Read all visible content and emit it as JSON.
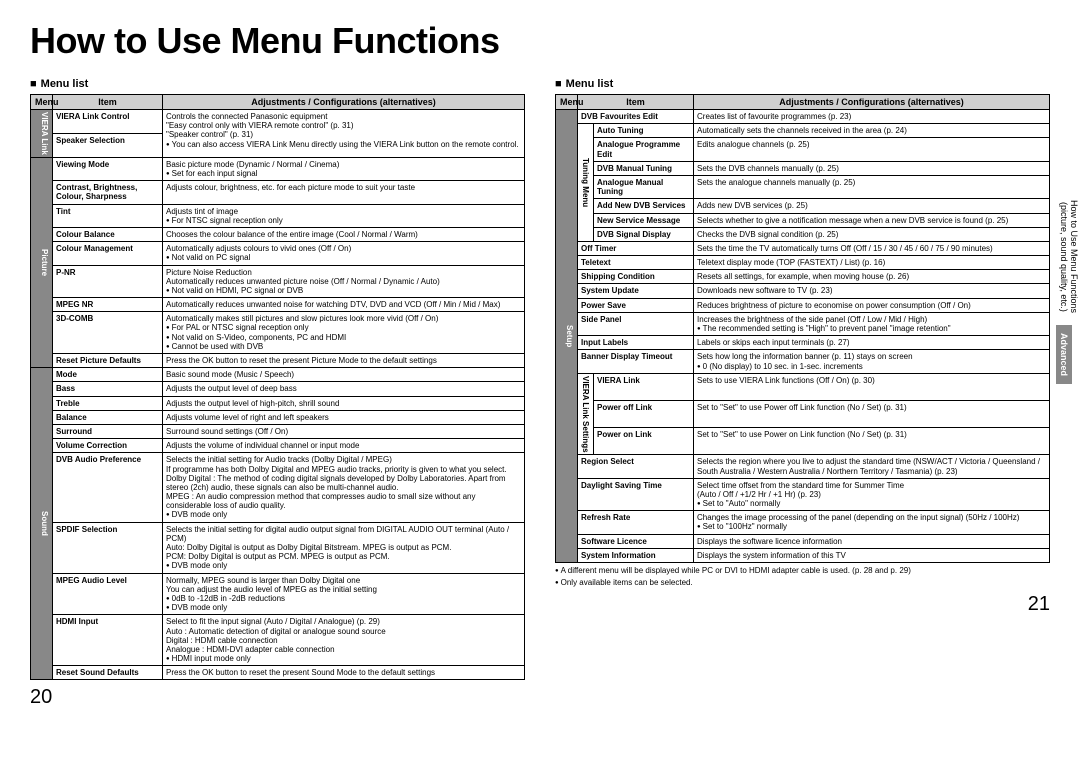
{
  "title": "How to Use Menu Functions",
  "menuListLabel": "Menu list",
  "headers": {
    "menu": "Menu",
    "item": "Item",
    "adj": "Adjustments / Configurations (alternatives)"
  },
  "pageLeft": "20",
  "pageRight": "21",
  "sideTab1a": "How to Use Menu Functions",
  "sideTab1b": "(picture, sound quality, etc.)",
  "sideTab2": "Advanced",
  "left": {
    "cats": [
      {
        "name": "VIERA Link",
        "rows": [
          {
            "item": "VIERA Link Control",
            "desc": "Controls the connected Panasonic equipment\n\"Easy control only with VIERA remote control\" (p. 31)\n\"Speaker control\" (p. 31)\n●You can also access VIERA Link Menu directly using the VIERA Link button on the remote control."
          },
          {
            "item": "Speaker Selection",
            "desc": ""
          }
        ]
      },
      {
        "name": "Picture",
        "rows": [
          {
            "item": "Viewing Mode",
            "desc": "Basic picture mode (Dynamic / Normal / Cinema)\n●Set for each input signal"
          },
          {
            "item": "Contrast, Brightness, Colour, Sharpness",
            "desc": "Adjusts colour, brightness, etc. for each picture mode to suit your taste"
          },
          {
            "item": "Tint",
            "desc": "Adjusts tint of image\n●For NTSC signal reception only"
          },
          {
            "item": "Colour Balance",
            "desc": "Chooses the colour balance of the entire image (Cool / Normal / Warm)"
          },
          {
            "item": "Colour Management",
            "desc": "Automatically adjusts colours to vivid ones (Off / On)\n●Not valid on PC signal"
          },
          {
            "item": "P-NR",
            "desc": "Picture Noise Reduction\nAutomatically reduces unwanted picture noise (Off / Normal / Dynamic / Auto)\n●Not valid on HDMI, PC signal or DVB"
          },
          {
            "item": "MPEG NR",
            "desc": "Automatically reduces unwanted noise for watching DTV, DVD and VCD (Off / Min / Mid / Max)"
          },
          {
            "item": "3D-COMB",
            "desc": "Automatically makes still pictures and slow pictures look more vivid (Off / On)\n●For PAL or NTSC signal reception only\n●Not valid on S-Video, components, PC and HDMI\n●Cannot be used with DVB"
          },
          {
            "item": "Reset Picture Defaults",
            "desc": "Press the OK button to reset the present Picture Mode to the default settings"
          }
        ]
      },
      {
        "name": "Sound",
        "rows": [
          {
            "item": "Mode",
            "desc": "Basic sound mode (Music / Speech)"
          },
          {
            "item": "Bass",
            "desc": "Adjusts the output level of deep bass"
          },
          {
            "item": "Treble",
            "desc": "Adjusts the output level of high-pitch, shrill sound"
          },
          {
            "item": "Balance",
            "desc": "Adjusts volume level of right and left speakers"
          },
          {
            "item": "Surround",
            "desc": "Surround sound settings (Off / On)"
          },
          {
            "item": "Volume Correction",
            "desc": "Adjusts the volume of individual channel or input mode"
          },
          {
            "item": "DVB Audio Preference",
            "desc": "Selects the initial setting for Audio tracks (Dolby Digital / MPEG)\nIf programme has both Dolby Digital and MPEG audio tracks, priority is given to what you select.\nDolby Digital : The method of coding digital signals developed by Dolby Laboratories. Apart from stereo (2ch) audio, these signals can also be multi-channel audio.\nMPEG : An audio compression method that compresses audio to small size without any considerable loss of audio quality.\n●DVB mode only"
          },
          {
            "item": "SPDIF Selection",
            "desc": "Selects the initial setting for digital audio output signal from DIGITAL AUDIO OUT terminal (Auto / PCM)\nAuto: Dolby Digital is output as Dolby Digital Bitstream. MPEG is output as PCM.\nPCM: Dolby Digital is output as PCM. MPEG is output as PCM.\n●DVB mode only"
          },
          {
            "item": "MPEG Audio Level",
            "desc": "Normally, MPEG sound is larger than Dolby Digital one\nYou can adjust the audio level of MPEG as the initial setting\n●0dB to -12dB in -2dB reductions\n●DVB mode only"
          },
          {
            "item": "HDMI Input",
            "desc": "Select to fit the input signal (Auto / Digital / Analogue) (p. 29)\nAuto     : Automatic detection of digital or analogue sound source\nDigital   : HDMI cable connection\nAnalogue : HDMI-DVI adapter cable connection\n●HDMI input mode only"
          },
          {
            "item": "Reset Sound Defaults",
            "desc": "Press the OK button to reset the present Sound Mode to the default settings"
          }
        ]
      }
    ]
  },
  "right": {
    "cat": "Setup",
    "tuning": {
      "name": "Tuning Menu",
      "rows": [
        {
          "item": "DVB Favourites Edit",
          "desc": "Creates list of favourite programmes (p. 23)"
        },
        {
          "item": "Auto Tuning",
          "desc": "Automatically sets the channels received in the area (p. 24)"
        },
        {
          "item": "Analogue Programme Edit",
          "desc": "Edits analogue channels (p. 25)"
        },
        {
          "item": "DVB Manual Tuning",
          "desc": "Sets the DVB channels manually (p. 25)"
        },
        {
          "item": "Analogue Manual Tuning",
          "desc": "Sets the analogue channels manually (p. 25)"
        },
        {
          "item": "Add New DVB Services",
          "desc": "Adds new DVB services (p. 25)"
        },
        {
          "item": "New Service Message",
          "desc": "Selects whether to give a notification message when a new DVB service is found (p. 25)"
        },
        {
          "item": "DVB Signal Display",
          "desc": "Checks the DVB signal condition (p. 25)"
        }
      ]
    },
    "rows1": [
      {
        "item": "Off Timer",
        "desc": "Sets the time the TV automatically turns Off (Off / 15 / 30 / 45 / 60 / 75 / 90 minutes)"
      },
      {
        "item": "Teletext",
        "desc": "Teletext display mode (TOP (FASTEXT) / List) (p. 16)"
      },
      {
        "item": "Shipping Condition",
        "desc": "Resets all settings, for example, when moving house (p. 26)"
      },
      {
        "item": "System Update",
        "desc": "Downloads new software to TV (p. 23)"
      },
      {
        "item": "Power Save",
        "desc": "Reduces brightness of picture to economise on power consumption (Off / On)"
      },
      {
        "item": "Side Panel",
        "desc": "Increases the brightness of the side panel (Off / Low / Mid / High)\n●The recommended setting is \"High\" to prevent panel \"image retention\""
      },
      {
        "item": "Input Labels",
        "desc": "Labels or skips each input terminals (p. 27)"
      },
      {
        "item": "Banner Display Timeout",
        "desc": "Sets how long the information banner (p. 11) stays on screen\n●0 (No display) to 10 sec. in 1-sec. increments"
      }
    ],
    "viera": {
      "name": "VIERA Link Settings",
      "rows": [
        {
          "item": "VIERA Link",
          "desc": "Sets to use VIERA Link functions (Off / On) (p. 30)"
        },
        {
          "item": "Power off Link",
          "desc": "Set to \"Set\" to use Power off Link function (No / Set) (p. 31)"
        },
        {
          "item": "Power on Link",
          "desc": "Set to \"Set\" to use Power on Link function (No / Set) (p. 31)"
        }
      ]
    },
    "rows2": [
      {
        "item": "Region Select",
        "desc": "Selects the region where you live to adjust the standard time (NSW/ACT / Victoria / Queensland / South Australia / Western Australia / Northern Territory / Tasmania) (p. 23)"
      },
      {
        "item": "Daylight Saving Time",
        "desc": "Select time offset from the standard time for Summer Time\n(Auto / Off / +1/2 Hr / +1 Hr) (p. 23)\n●Set to \"Auto\" normally"
      },
      {
        "item": "Refresh Rate",
        "desc": "Changes the image processing of the panel (depending on the input signal) (50Hz / 100Hz)\n●Set to \"100Hz\" normally"
      },
      {
        "item": "Software Licence",
        "desc": "Displays the software licence information"
      },
      {
        "item": "System Information",
        "desc": "Displays the system information of this TV"
      }
    ],
    "footnotes": [
      "A different menu will be displayed while PC or DVI to HDMI adapter cable is used. (p. 28 and p. 29)",
      "Only available items can be selected."
    ]
  }
}
